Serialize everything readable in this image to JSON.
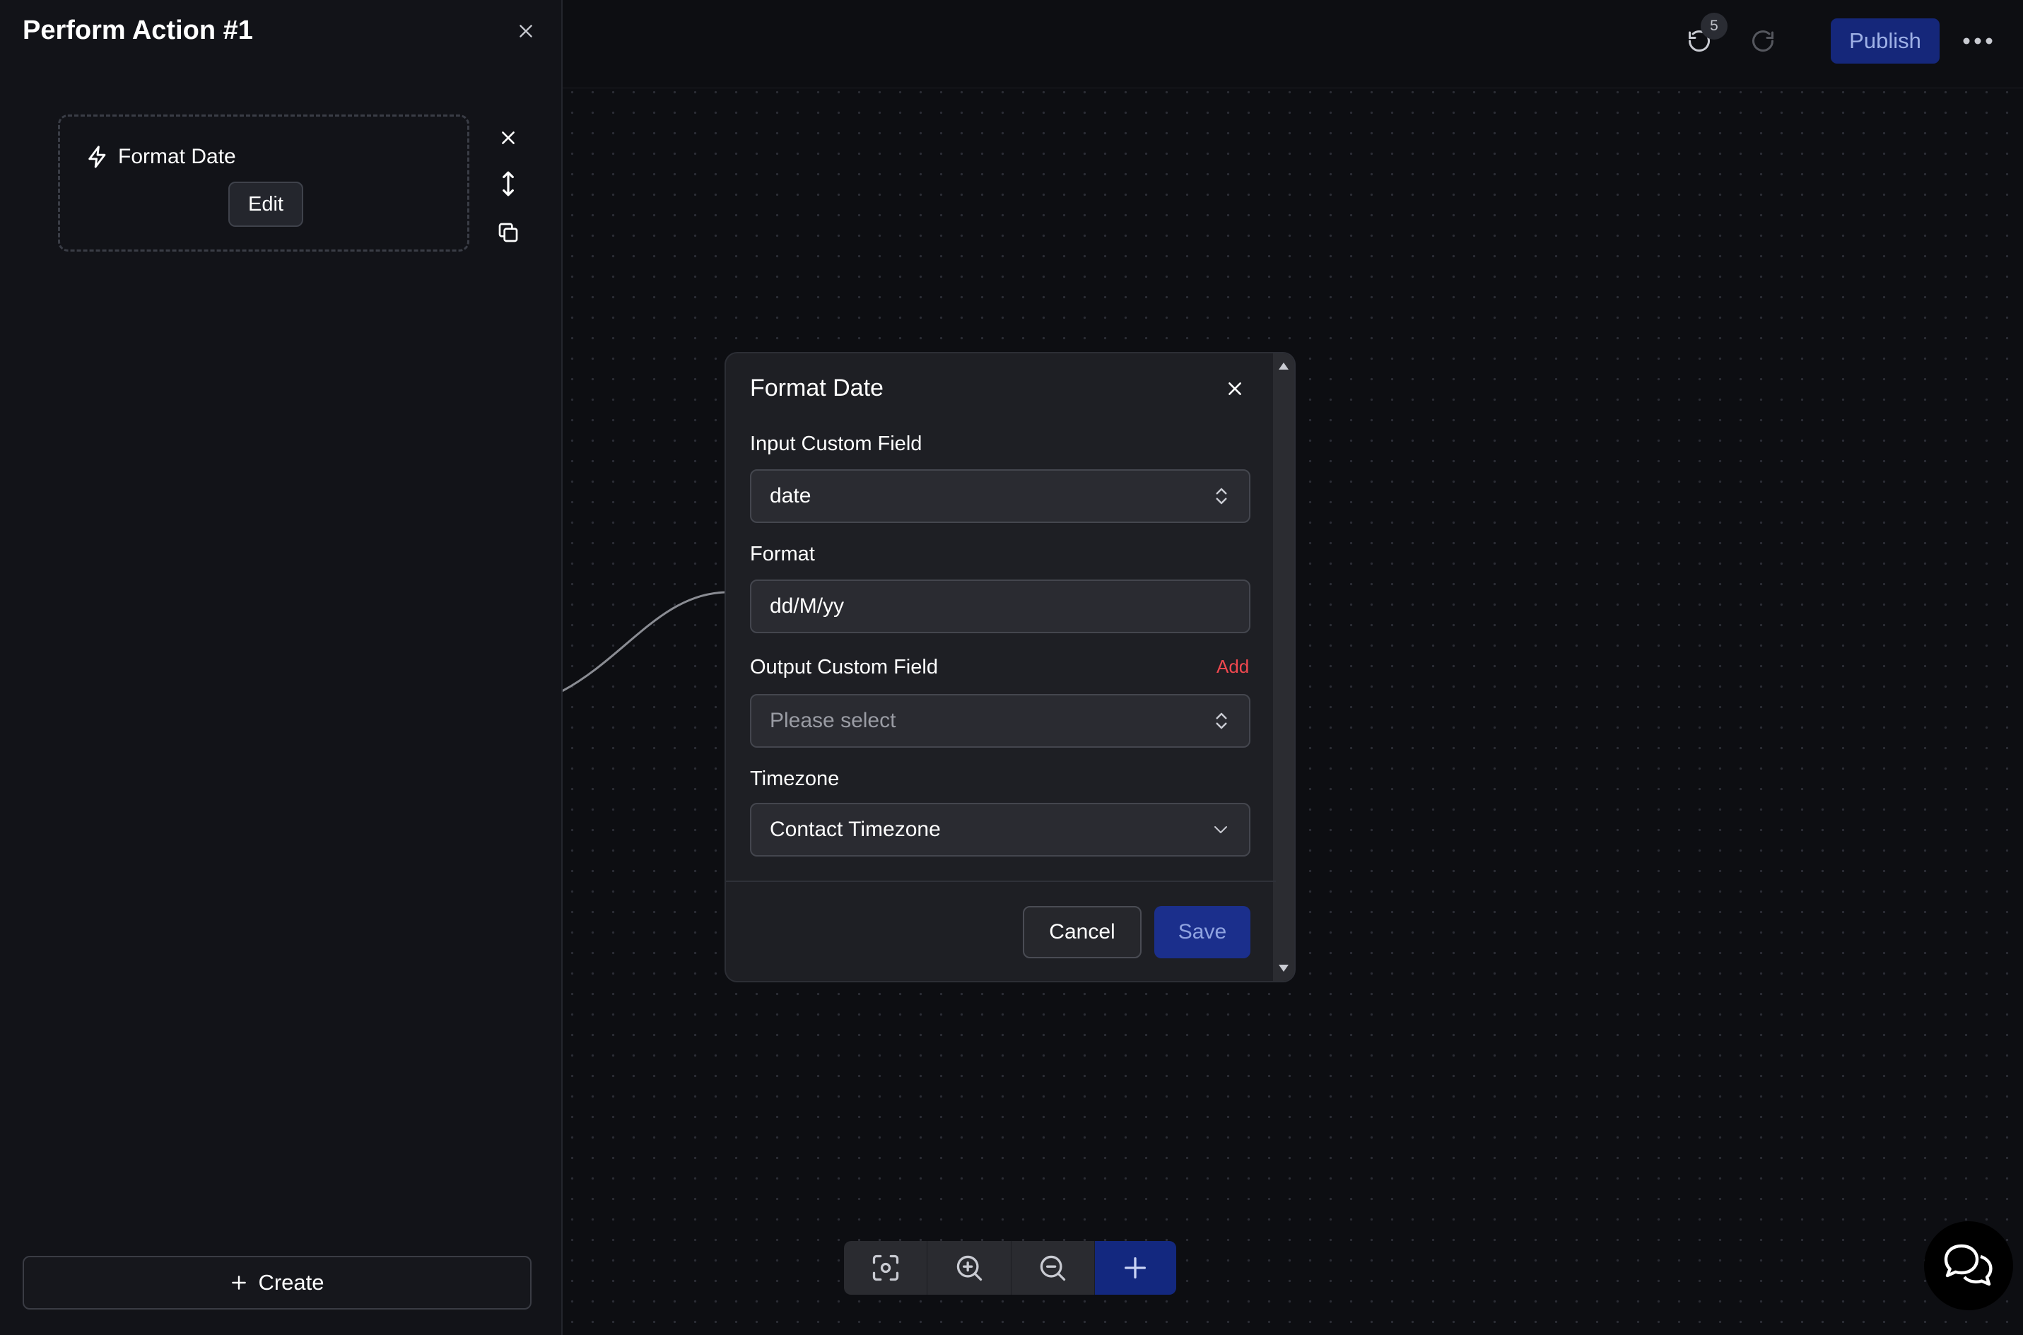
{
  "sidebar": {
    "title": "Perform Action #1",
    "action_card": {
      "name": "Format Date",
      "edit_label": "Edit"
    },
    "create_label": "Create"
  },
  "topbar": {
    "undo_count": "5",
    "publish_label": "Publish"
  },
  "modal": {
    "title": "Format Date",
    "fields": {
      "input_custom_field": {
        "label": "Input Custom Field",
        "value": "date"
      },
      "format": {
        "label": "Format",
        "value": "dd/M/yy"
      },
      "output_custom_field": {
        "label": "Output Custom Field",
        "add_label": "Add",
        "placeholder": "Please select"
      },
      "timezone": {
        "label": "Timezone",
        "value": "Contact Timezone"
      }
    },
    "cancel_label": "Cancel",
    "save_label": "Save"
  },
  "colors": {
    "accent": "#1b2f8c",
    "add_link": "#f0484f",
    "background": "#0d0e12",
    "sidebar": "#121318"
  }
}
